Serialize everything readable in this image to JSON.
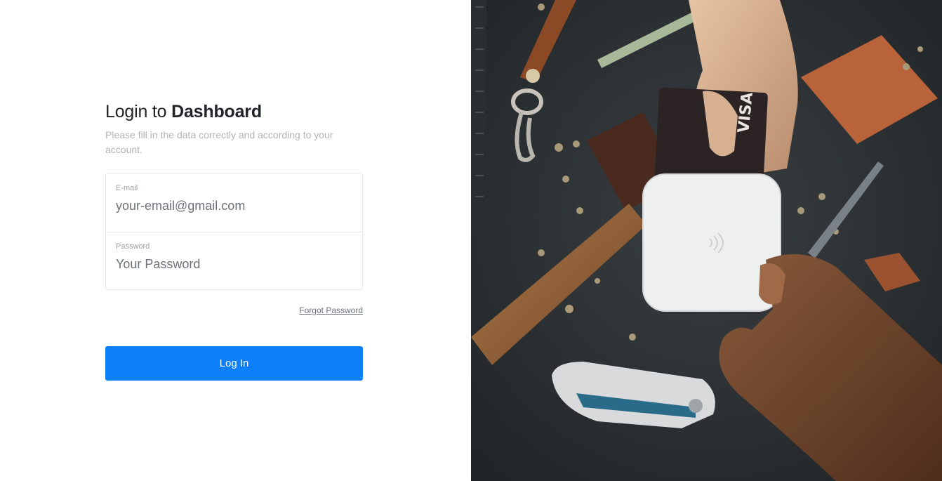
{
  "login": {
    "title_prefix": "Login to ",
    "title_strong": "Dashboard",
    "subtitle": "Please fill in the data correctly and according to your account.",
    "email": {
      "label": "E-mail",
      "placeholder": "your-email@gmail.com",
      "value": ""
    },
    "password": {
      "label": "Password",
      "placeholder": "Your Password",
      "value": ""
    },
    "forgot_label": "Forgot Password",
    "submit_label": "Log In"
  },
  "colors": {
    "accent": "#0d7ff9",
    "background_dark": "#2c3033"
  },
  "hero": {
    "icon": "card-payment-photo"
  }
}
